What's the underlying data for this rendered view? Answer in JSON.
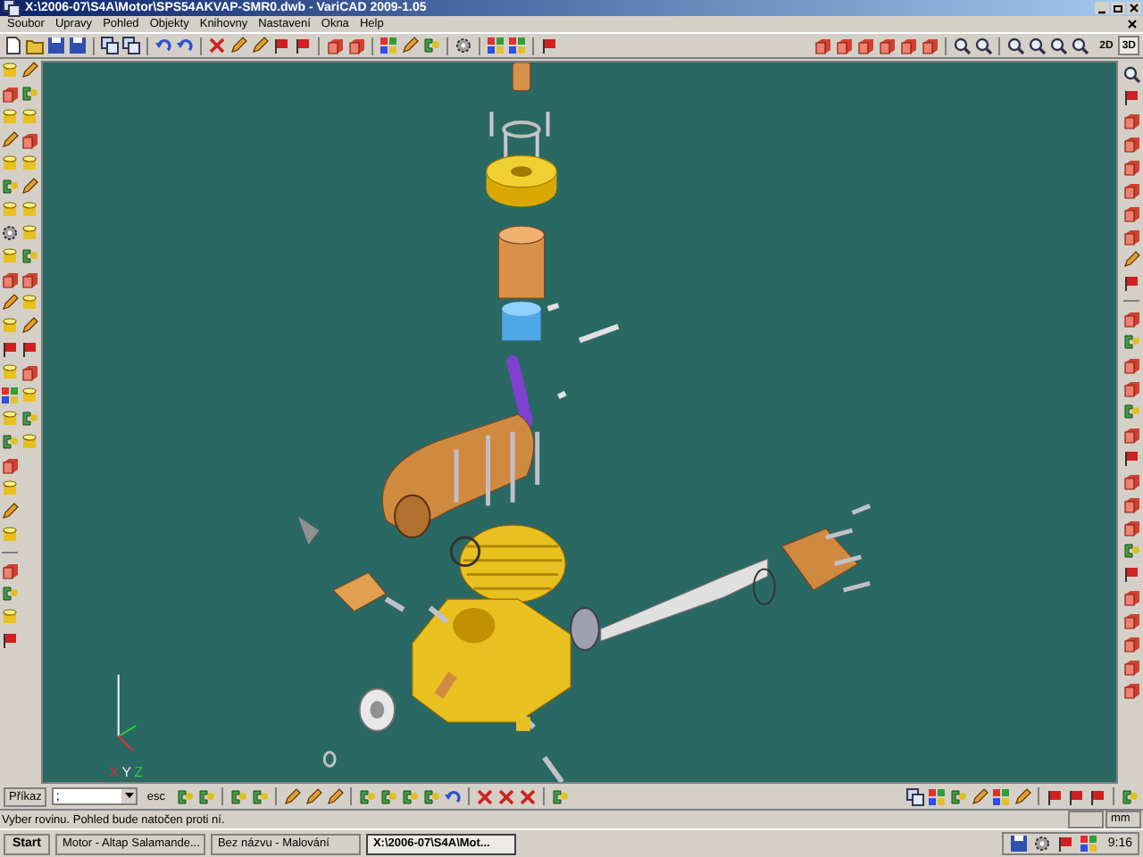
{
  "window": {
    "title": "X:\\2006-07\\S4A\\Motor\\SPS54AKVAP-SMR0.dwb - VariCAD 2009-1.05"
  },
  "menu": [
    "Soubor",
    "Upravy",
    "Pohled",
    "Objekty",
    "Knihovny",
    "Nastavení",
    "Okna",
    "Help"
  ],
  "view_toggle": [
    {
      "label": "2D",
      "selected": false
    },
    {
      "label": "3D",
      "selected": true
    }
  ],
  "axes": {
    "labels": [
      "X",
      "Y",
      "Z"
    ]
  },
  "command_line": {
    "label": "Příkaz",
    "value": ";",
    "esc": "esc"
  },
  "status_bar": {
    "message": "Vyber rovinu. Pohled bude natočen proti ní.",
    "units": "mm"
  },
  "taskbar": {
    "start": "Start",
    "tasks": [
      {
        "label": "Motor - Altap Salamande...",
        "selected": false
      },
      {
        "label": "Bez názvu - Malování",
        "selected": false
      },
      {
        "label": "X:\\2006-07\\S4A\\Mot...",
        "selected": true
      }
    ],
    "clock": "9:16"
  }
}
